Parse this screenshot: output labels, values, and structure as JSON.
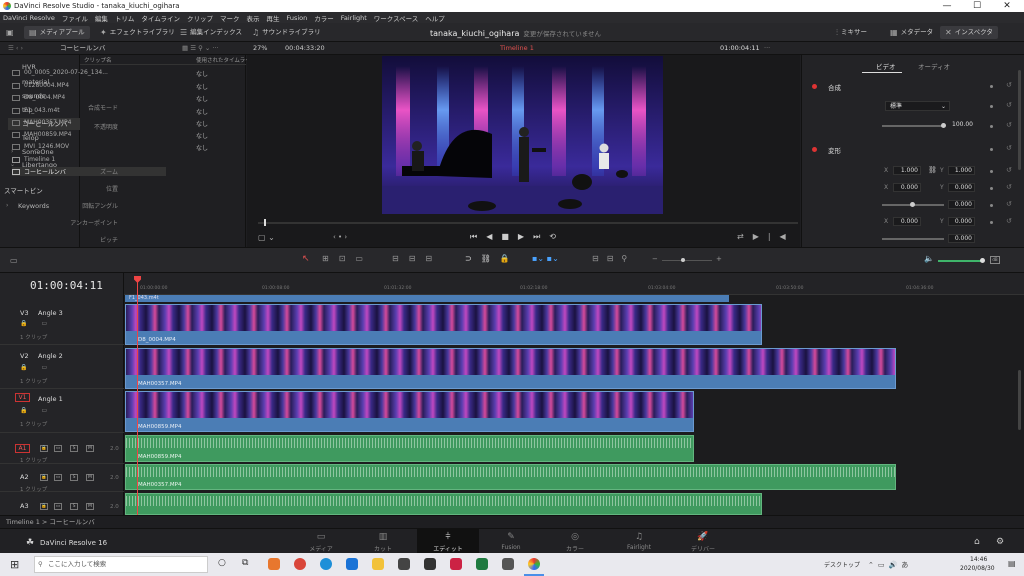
{
  "window": {
    "title": "DaVinci Resolve Studio - tanaka_kiuchi_ogihara",
    "min": "—",
    "max": "☐",
    "close": "✕"
  },
  "menu": [
    "DaVinci Resolve",
    "ファイル",
    "編集",
    "トリム",
    "タイムライン",
    "クリップ",
    "マーク",
    "表示",
    "再生",
    "Fusion",
    "カラー",
    "Fairlight",
    "ワークスペース",
    "ヘルプ"
  ],
  "toolbar": {
    "media_pool": "メディアプール",
    "effects": "エフェクトライブラリ",
    "edit_index": "編集インデックス",
    "sound_library": "サウンドライブラリ",
    "project": "tanaka_kiuchi_ogihara",
    "unsaved": "変更が保存されていません",
    "mixer": "ミキサー",
    "metadata": "メタデータ",
    "inspector": "インスペクタ"
  },
  "subbar": {
    "bin_path": "コーヒールンバ",
    "zoom": "27%",
    "source_tc": "00:04:33:20",
    "timeline_name": "Timeline 1",
    "viewer_tc": "01:00:04:11"
  },
  "bins": [
    {
      "label": "HVR"
    },
    {
      "label": "material"
    },
    {
      "label": "sounds"
    },
    {
      "label": "top"
    },
    {
      "label": "コーヒールンバ"
    },
    {
      "label": "Telop"
    },
    {
      "label": "SomeOne"
    },
    {
      "label": "Libertango"
    }
  ],
  "smart_bins": {
    "label": "スマートビン",
    "keywords": "Keywords"
  },
  "clip_headers": {
    "name": "クリップ名",
    "used": "使用されたタイムライン"
  },
  "clips": [
    {
      "name": "00_0005_2020-07-26_134...",
      "used": "なし"
    },
    {
      "name": "01280004.MP4",
      "used": "なし"
    },
    {
      "name": "D8_0004.MP4",
      "used": "なし"
    },
    {
      "name": "F1_043.m4t",
      "used": "なし"
    },
    {
      "name": "MAH00357.MP4",
      "used": "なし"
    },
    {
      "name": "MAH00859.MP4",
      "used": "なし"
    },
    {
      "name": "MVI_1246.MOV",
      "used": "なし"
    },
    {
      "name": "Timeline 1",
      "used": ""
    },
    {
      "name": "コーヒールンバ",
      "used": ""
    }
  ],
  "inspector": {
    "tab_video": "ビデオ",
    "tab_audio": "オーディオ",
    "composite": "合成",
    "composite_mode_label": "合成モード",
    "composite_mode": "標準",
    "opacity_label": "不透明度",
    "opacity": "100.00",
    "transform": "変形",
    "zoom_label": "ズーム",
    "zoom_x": "1.000",
    "zoom_y": "1.000",
    "position_label": "位置",
    "pos_x": "0.000",
    "pos_y": "0.000",
    "rotation_label": "回転アングル",
    "rotation": "0.000",
    "anchor_label": "アンカーポイント",
    "anchor_x": "0.000",
    "anchor_y": "0.000",
    "pitch_label": "ピッチ",
    "pitch": "0.000",
    "x": "X",
    "y": "Y"
  },
  "timeline": {
    "timecode": "01:00:04:11",
    "ruler": [
      "01:00:00:00",
      "01:00:08:00",
      "01:01:32:00",
      "01:02:18:00",
      "01:03:04:00",
      "01:03:50:00",
      "01:04:36:00"
    ],
    "tracks": [
      {
        "id": "V3",
        "name": "Angle 3",
        "sub": "1 クリップ",
        "clip": "D8_0004.MP4"
      },
      {
        "id": "V2",
        "name": "Angle 2",
        "sub": "1 クリップ",
        "clip": "MAH00357.MP4"
      },
      {
        "id": "V1",
        "name": "Angle 1",
        "sub": "1 クリップ",
        "clip": "MAH00859.MP4"
      },
      {
        "id": "A1",
        "name": "",
        "sub": "1 クリップ",
        "clip": "MAH00859.MP4",
        "ch": "2.0"
      },
      {
        "id": "A2",
        "name": "",
        "sub": "1 クリップ",
        "clip": "MAH00357.MP4",
        "ch": "2.0"
      },
      {
        "id": "A3",
        "name": "",
        "sub": "",
        "clip": "",
        "ch": "2.0"
      }
    ],
    "top_clip": "F1_043.m4t"
  },
  "breadcrumb": "Timeline 1  >  コーヒールンバ",
  "pages": [
    "メディア",
    "カット",
    "エディット",
    "Fusion",
    "カラー",
    "Fairlight",
    "デリバー"
  ],
  "brand": "DaVinci Resolve 16",
  "taskbar": {
    "search": "ここに入力して検索",
    "desktop": "デスクトップ",
    "time": "14:46",
    "date": "2020/08/30"
  }
}
